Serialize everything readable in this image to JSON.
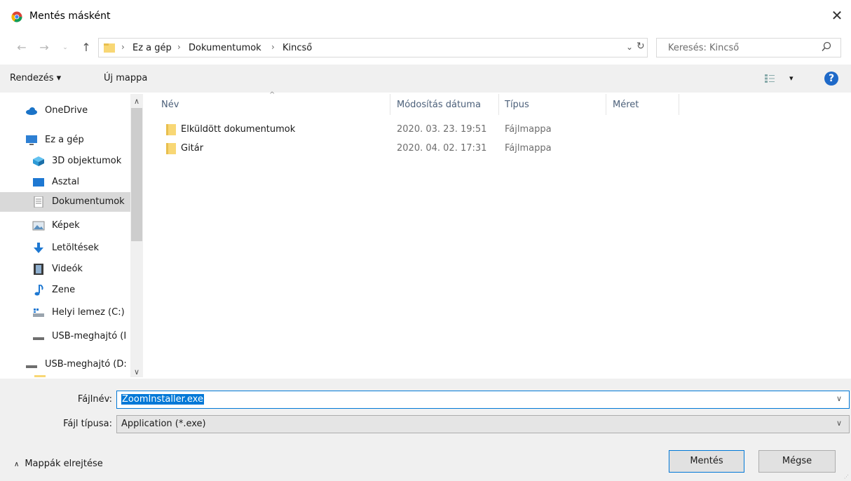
{
  "window": {
    "title": "Mentés másként"
  },
  "address": {
    "crumbs": [
      "Ez a gép",
      "Dokumentumok",
      "Kincső"
    ],
    "separator": "›"
  },
  "search": {
    "placeholder": "Keresés: Kincső"
  },
  "toolbar": {
    "organize_label": "Rendezés ▾",
    "new_folder_label": "Új mappa",
    "view_label": "▾",
    "help_label": "?"
  },
  "sidebar": {
    "items": [
      {
        "label": "OneDrive",
        "icon": "cloud-icon"
      },
      {
        "label": "Ez a gép",
        "icon": "computer-icon"
      },
      {
        "label": "3D objektumok",
        "icon": "cube-icon"
      },
      {
        "label": "Asztal",
        "icon": "desktop-icon"
      },
      {
        "label": "Dokumentumok",
        "icon": "document-icon",
        "selected": true
      },
      {
        "label": "Képek",
        "icon": "pictures-icon"
      },
      {
        "label": "Letöltések",
        "icon": "download-icon"
      },
      {
        "label": "Videók",
        "icon": "film-icon"
      },
      {
        "label": "Zene",
        "icon": "music-note-icon"
      },
      {
        "label": "Helyi lemez (C:)",
        "icon": "drive-icon"
      },
      {
        "label": "USB-meghajtó (I",
        "icon": "usb-drive-icon"
      },
      {
        "label": "USB-meghajtó (D:",
        "icon": "usb-drive-icon"
      }
    ]
  },
  "columns": {
    "name": "Név",
    "date": "Módosítás dátuma",
    "type": "Típus",
    "size": "Méret"
  },
  "files": [
    {
      "name": "Elküldött dokumentumok",
      "date": "2020. 03. 23. 19:51",
      "type": "Fájlmappa"
    },
    {
      "name": "Gitár",
      "date": "2020. 04. 02. 17:31",
      "type": "Fájlmappa"
    }
  ],
  "form": {
    "filename_label": "Fájlnév:",
    "filename_value": "ZoomInstaller.exe",
    "filetype_label": "Fájl típusa:",
    "filetype_value": "Application (*.exe)"
  },
  "footer": {
    "hide_folders_label": "Mappák elrejtése",
    "save_label": "Mentés",
    "cancel_label": "Mégse"
  },
  "colors": {
    "accent": "#0078d7",
    "selected_row": "#d9d9d9",
    "folder": "#f8d775"
  }
}
